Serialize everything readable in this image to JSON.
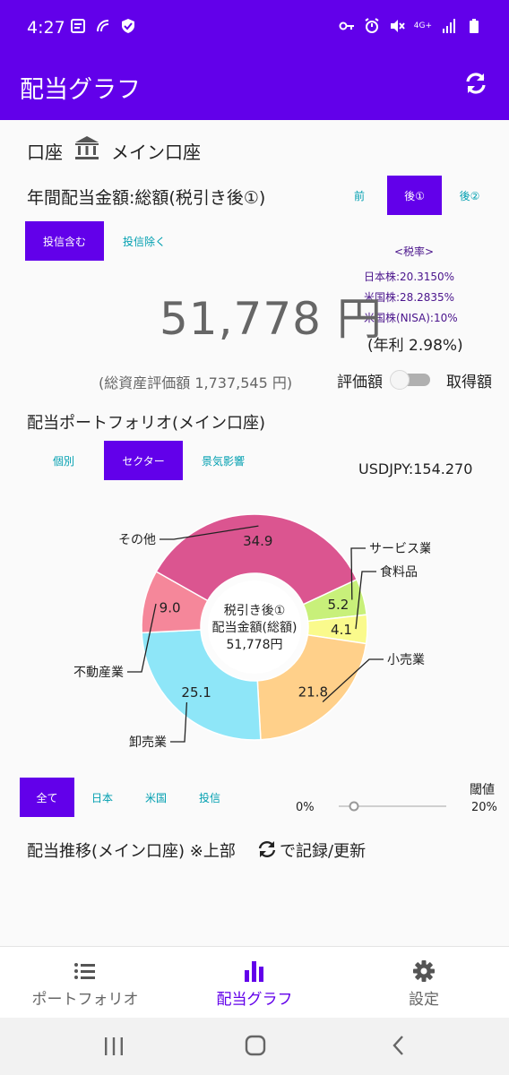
{
  "status_bar": {
    "time": "4:27",
    "network": "4G+"
  },
  "app_bar": {
    "title": "配当グラフ",
    "refresh_icon": "refresh-icon"
  },
  "account": {
    "label": "口座",
    "name": "メイン口座",
    "icon": "bank-icon"
  },
  "annual_dividend": {
    "label": "年間配当金額:総額(税引き後①)",
    "tax_mode_tabs": [
      {
        "label": "前",
        "active": false
      },
      {
        "label": "後①",
        "active": true
      },
      {
        "label": "後②",
        "active": false
      }
    ],
    "fund_tabs": [
      {
        "label": "投信含む",
        "active": true
      },
      {
        "label": "投信除く",
        "active": false
      }
    ],
    "tax_rates": {
      "title": "<税率>",
      "lines": [
        "日本株:20.3150%",
        "米国株:28.2835%",
        "米国株(NISA):10%"
      ]
    },
    "amount": "51,778 円",
    "yield": "(年利 2.98%)",
    "total_assets": "(総資産評価額 1,737,545 円)",
    "toggle": {
      "left_label": "評価額",
      "right_label": "取得額",
      "on": false
    }
  },
  "portfolio": {
    "label": "配当ポートフォリオ(メイン口座)",
    "view_tabs": [
      {
        "label": "個別",
        "active": false
      },
      {
        "label": "セクター",
        "active": true
      },
      {
        "label": "景気影響",
        "active": false
      }
    ],
    "usdjpy": "USDJPY:154.270"
  },
  "chart_data": {
    "type": "pie",
    "donut": true,
    "center_text": [
      "税引き後①",
      "配当金額(総額)",
      "51,778円"
    ],
    "slices": [
      {
        "label": "サービス業",
        "value": 5.2,
        "color": "#c8f07a"
      },
      {
        "label": "食料品",
        "value": 4.1,
        "color": "#fafa8c"
      },
      {
        "label": "小売業",
        "value": 21.8,
        "color": "#ffd08a"
      },
      {
        "label": "卸売業",
        "value": 25.1,
        "color": "#8ee6f8"
      },
      {
        "label": "不動産業",
        "value": 9.0,
        "color": "#f5879a"
      },
      {
        "label": "その他",
        "value": 34.9,
        "color": "#db5590"
      }
    ]
  },
  "filter": {
    "tabs": [
      {
        "label": "全て",
        "active": true
      },
      {
        "label": "日本",
        "active": false
      },
      {
        "label": "米国",
        "active": false
      },
      {
        "label": "投信",
        "active": false
      }
    ],
    "threshold_label": "閾値",
    "min_label": "0%",
    "max_label": "20%",
    "slider_value": 0
  },
  "trend": {
    "label": "配当推移(メイン口座) ※上部",
    "suffix": "で記録/更新"
  },
  "bottom_nav": [
    {
      "label": "ポートフォリオ",
      "icon": "list-icon",
      "active": false
    },
    {
      "label": "配当グラフ",
      "icon": "bar-chart-icon",
      "active": true
    },
    {
      "label": "設定",
      "icon": "gear-icon",
      "active": false
    }
  ]
}
